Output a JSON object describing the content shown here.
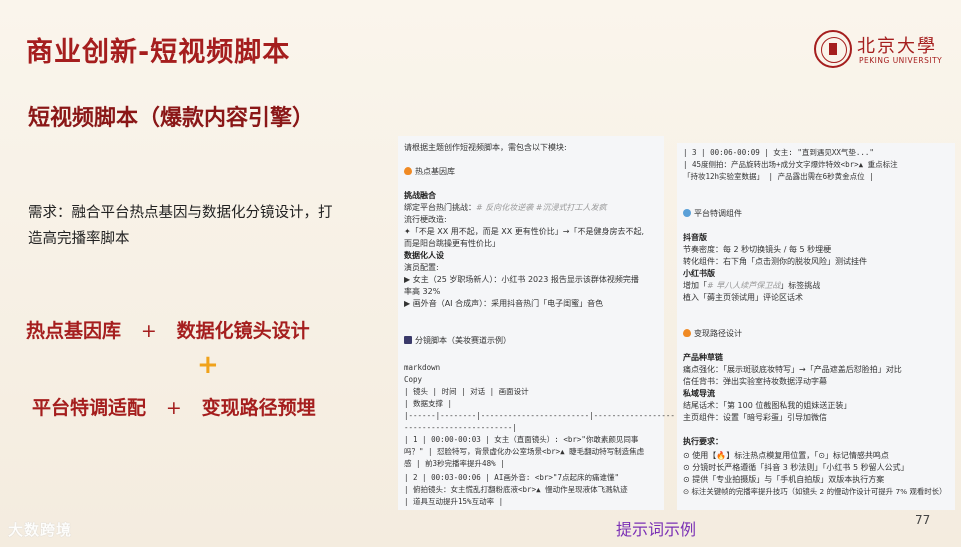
{
  "slide": {
    "title": "商业创新-短视频脚本",
    "logo": {
      "cn": "北京大學",
      "en": "PEKING UNIVERSITY"
    },
    "subtitle": "短视频脚本（爆款内容引擎）",
    "need_line1": "需求：融合平台热点基因与数据化分镜设计，打",
    "need_line2": "造高完播率脚本",
    "row1_a": "热点基因库",
    "row1_op": "+",
    "row1_b": "数据化镜头设计",
    "plus": "+",
    "row2_a": "平台特调适配",
    "row2_op": "+",
    "row2_b": "变现路径预埋",
    "caption": "提示词示例",
    "page_number": "77",
    "watermark": "大数跨境"
  },
  "left_panel": {
    "intro": "请根据主题创作短视频脚本，需包含以下模块:",
    "sec1_title": "热点基因库",
    "l_challenge": "挑战融合",
    "l_bind_a": "绑定平台热门挑战：",
    "l_bind_b": "# 反向化妆逆袭 #沉浸式打工人发疯",
    "l_meme": "流行梗改造:",
    "l_meme1": "✦「不是 XX 用不起，而是 XX 更有性价比」→「不是健身房去不起,",
    "l_meme2": "而是阳台跳操更有性价比」",
    "l_persona": "数据化人设",
    "l_cast": "演员配置:",
    "l_cast1": "▶ 女主（25 岁职场新人）：小红书 2023 报告显示该群体视频完播",
    "l_cast2": "率高 32%",
    "l_voice": "▶ 画外音（AI 合成声）：采用抖音热门「电子闺蜜」音色",
    "sec2_title": "分镜脚本（美妆赛道示例）",
    "c_markdown": "markdown",
    "c_copy": "Copy",
    "c_head1": "| 镜头 | 时间   | 对话                   | 画面设计",
    "c_head2": "                    | 数据支撑             |",
    "c_sep1": "|------|--------|------------------------|------------------",
    "c_sep2": "------------------------|",
    "c_r1a": "| 1    | 00:00-00:03 | 女主（直面镜头）: <br>\"你敢素颜见同事",
    "c_r1b": "吗？\" | 怼脸特写，背景虚化办公室场景<br>▲ 睫毛翻动特写制造焦虑",
    "c_r1c": "感                    | 前3秒完播率提升48%    |",
    "c_r2a": "| 2    | 00:03-00:06 | AI画外音: <br>\"7点起床的痛谁懂\"",
    "c_r2b": "    | 俯拍镜头：女主慌乱打翻粉底液<br>▲ 慢动作呈现液体飞溅轨迹",
    "c_r2c": "                    | 道具互动提升15%互动率    |"
  },
  "right_panel": {
    "r3a": "| 3    | 00:06-00:09 | 女主: \"直到遇见XX气垫...\"",
    "r3b": "    | 45度侧拍：产品旋转出场+成分文字爆炸特效<br>▲ 重点标注",
    "r3c": "「持妆12h实验室数据」  | 产品露出需在6秒黄金点位 |",
    "sec3_title": "平台特调组件",
    "dy_title": "抖音版",
    "dy_1": "节奏密度：每 2 秒切换镜头 / 每 5 秒埋梗",
    "dy_2": "转化组件：右下角「点击测你的脱妆风险」测试挂件",
    "xhs_title": "小红书版",
    "xhs_1a": "增加「",
    "xhs_1b": "# 早八人续芦保卫战",
    "xhs_1c": "」标签挑战",
    "xhs_2": "植入「薅主页领试用」评论区话术",
    "sec4_title": "变现路径设计",
    "chain_title": "产品种草链",
    "chain_1": "痛点强化：「展示斑驳底妆特写」→「产品遮盖后怼脸拍」对比",
    "chain_2": "信任背书：弹出实验室持妆数据浮动字幕",
    "priv_title": "私域导流",
    "priv_1": "结尾话术：「第 100 位截图私我的姐妹送正装」",
    "priv_2": "主页组件：设置「暗号彩蛋」引导加微信",
    "req_title": "执行要求：",
    "req_1": "⊙ 使用【🔥】标注热点模复用位置，「⊙」标记情感共鸣点",
    "req_2": "⊙ 分镜时长严格遵循「抖音 3 秒法则」「小红书 5 秒留人公式」",
    "req_3": "⊙ 提供「专业拍摄版」与「手机自拍版」双版本执行方案",
    "req_4": "⊙ 标注关键帧的完播率提升技巧（如镜头 2 的慢动作设计可提升 7% 观看时长）"
  }
}
